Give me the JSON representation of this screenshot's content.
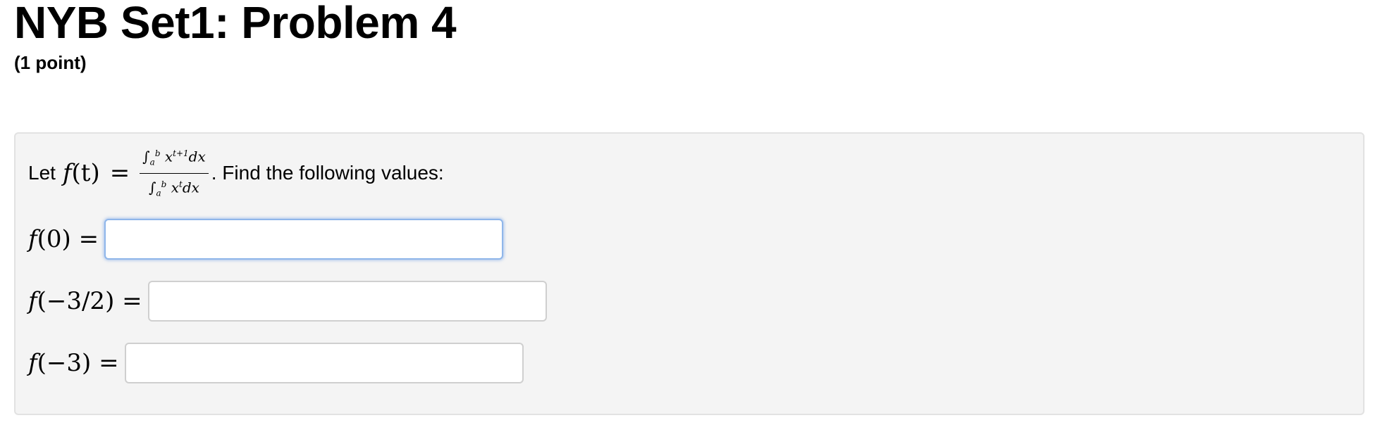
{
  "problem": {
    "title": "NYB Set1: Problem 4",
    "points": "(1 point)"
  },
  "statement": {
    "prefix": "Let",
    "lhs_func": "f",
    "lhs_arg": "(t)",
    "equals": "=",
    "numerator": {
      "integral": "∫",
      "upper": "b",
      "lower": "a",
      "base": "x",
      "exponent": "t+1",
      "differential": "dx"
    },
    "denominator": {
      "integral": "∫",
      "upper": "b",
      "lower": "a",
      "base": "x",
      "exponent": "t",
      "differential": "dx"
    },
    "suffix": ". Find the following values:"
  },
  "answers": [
    {
      "func": "f",
      "arg": "(0)",
      "equals": "=",
      "value": "",
      "focused": true
    },
    {
      "func": "f",
      "arg": "(−3/2)",
      "equals": "=",
      "value": "",
      "focused": false
    },
    {
      "func": "f",
      "arg": "(−3)",
      "equals": "=",
      "value": "",
      "focused": false
    }
  ],
  "colors": {
    "panel_bg": "#f4f4f4",
    "panel_border": "#e2e2e2",
    "focus_border": "#8fb6ea"
  }
}
